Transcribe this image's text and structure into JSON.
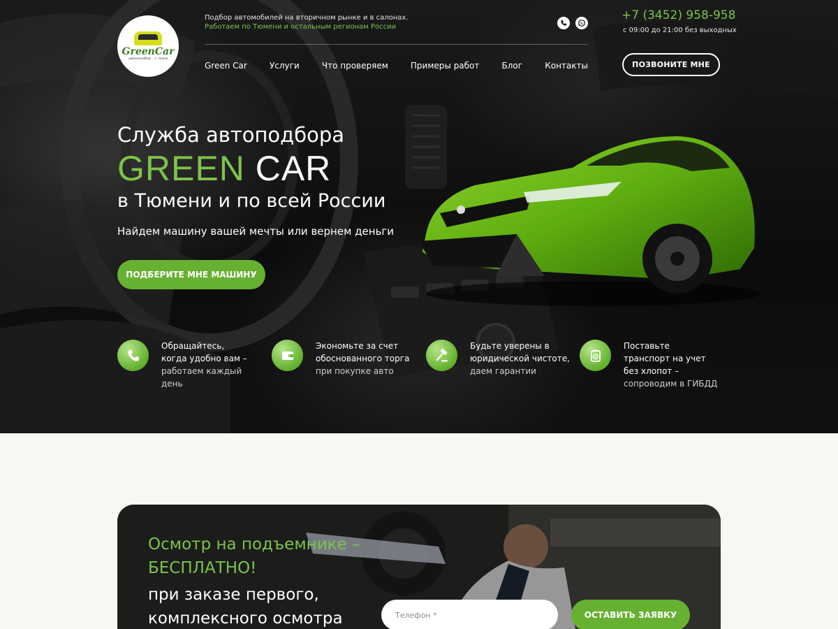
{
  "header": {
    "logo_text": "GreenCar",
    "logo_sub": "автоподбор · г. тюм",
    "tagline_line1": "Подбор автомобилей на вторичном рынке и в салонах.",
    "tagline_line2": "Работаем по Тюмени и остальным регионам России",
    "phone": "+7 (3452) 958-958",
    "hours": "с 09:00 до 21:00 без выходных",
    "call_button": "ПОЗВОНИТЕ МНЕ",
    "social_icons": [
      "viber-icon",
      "whatsapp-icon"
    ]
  },
  "nav": {
    "items": [
      {
        "label": "Green Car"
      },
      {
        "label": "Услуги"
      },
      {
        "label": "Что проверяем"
      },
      {
        "label": "Примеры работ"
      },
      {
        "label": "Блог"
      },
      {
        "label": "Контакты"
      }
    ]
  },
  "hero": {
    "service": "Служба автоподбора",
    "brand_green": "GREEN",
    "brand_white": "CAR",
    "city": "в Тюмени и по всей России",
    "tagline": "Найдем машину вашей мечты или вернем деньги",
    "cta": "ПОДБЕРИТЕ МНЕ МАШИНУ"
  },
  "features": [
    {
      "icon": "phone-icon",
      "line1": "Обращайтесь,",
      "line2": "когда удобно вам –",
      "sub1": "работаем каждый",
      "sub2": "день"
    },
    {
      "icon": "wallet-icon",
      "line1": "Экономьте за счет",
      "line2": "обоснованного торга",
      "sub1": "при покупке авто",
      "sub2": ""
    },
    {
      "icon": "gavel-icon",
      "line1": "Будьте уверены в",
      "line2": "юридической чистоте,",
      "sub1": "даем гарантии",
      "sub2": ""
    },
    {
      "icon": "clipboard-check-icon",
      "line1": "Поставьте",
      "line2": "транспорт на учет",
      "line3": "без хлопот –",
      "sub1": "сопроводим в ГИБДД"
    }
  ],
  "banner": {
    "title_line1": "Осмотр на подъемнике –",
    "title_line2": "БЕСПЛАТНО!",
    "sub_line1": "при заказе первого,",
    "sub_line2": "комплексного осмотра",
    "phone_placeholder": "Телефон *",
    "submit": "ОСТАВИТЬ ЗАЯВКУ"
  },
  "colors": {
    "accent": "#66b132",
    "accent_text": "#7cc44a",
    "hero_bg": "#0c0c0c",
    "page_bg": "#f7f7f3"
  }
}
